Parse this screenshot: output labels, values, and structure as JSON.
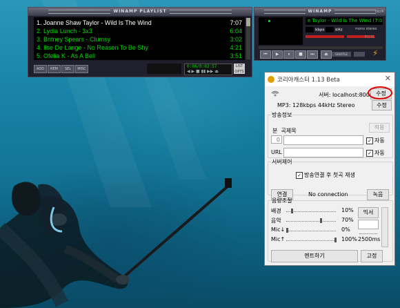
{
  "playlist": {
    "title": "WINAMP PLAYLIST",
    "tracks": [
      {
        "label": "1. Joanne Shaw Taylor - Wild Is The Wind",
        "time": "7:07"
      },
      {
        "label": "2. Lydia Lunch - 3x3",
        "time": "6:04"
      },
      {
        "label": "3. Britney Spears - Clumsy",
        "time": "3:02"
      },
      {
        "label": "4. Ilse De Lange - No Reason To Be Shy",
        "time": "4:21"
      },
      {
        "label": "5. Ofelia K - As A Bell",
        "time": "3:51"
      }
    ],
    "buttons": [
      "ADD",
      "REM",
      "SEL",
      "MISC"
    ],
    "time_display": "0:00/0:02:57",
    "list_opts": "LIST OPTS"
  },
  "winamp": {
    "title": "WINAMP",
    "marquee": "e Taylor - Wild Is The Wind (7:07",
    "kbps_label": "kbps",
    "khz_label": "kHz",
    "mono_label": "mono",
    "stereo_label": "stereo",
    "eq_label": "EQ",
    "pl_label": "PL",
    "shuffle_label": "SHUFFLE"
  },
  "dialog": {
    "title": "코리아캐스터 1.13 Beta",
    "server_label": "서버: localhost:8000",
    "server_edit": "수정",
    "mp3_label": "MP3: 128kbps 44kHz Stereo",
    "mp3_edit": "수정",
    "broadcast_info": {
      "legend": "방송정보",
      "apply": "적용",
      "col_num": "분",
      "col_title": "곡제목",
      "num_value": "0",
      "auto_label": "자동",
      "url_label": "URL",
      "url_auto_label": "자동"
    },
    "server_control": {
      "legend": "서버제어",
      "auto_play_label": "방송연결 후 첫곡 재생",
      "connect": "연결",
      "status": "No connection",
      "record": "녹음"
    },
    "volume_control": {
      "legend": "음량조절",
      "rows": [
        {
          "label": "배경",
          "value": "10%",
          "level": 0.1
        },
        {
          "label": "음악",
          "value": "70%",
          "level": 0.7
        },
        {
          "label": "Mic↓",
          "value": "0%",
          "level": 0
        },
        {
          "label": "Mic↑",
          "value": "100%",
          "level": 1.0
        }
      ],
      "mixer": "믹서",
      "ms_value": "2500ms",
      "ment": "멘트하기",
      "fix": "고정"
    }
  }
}
